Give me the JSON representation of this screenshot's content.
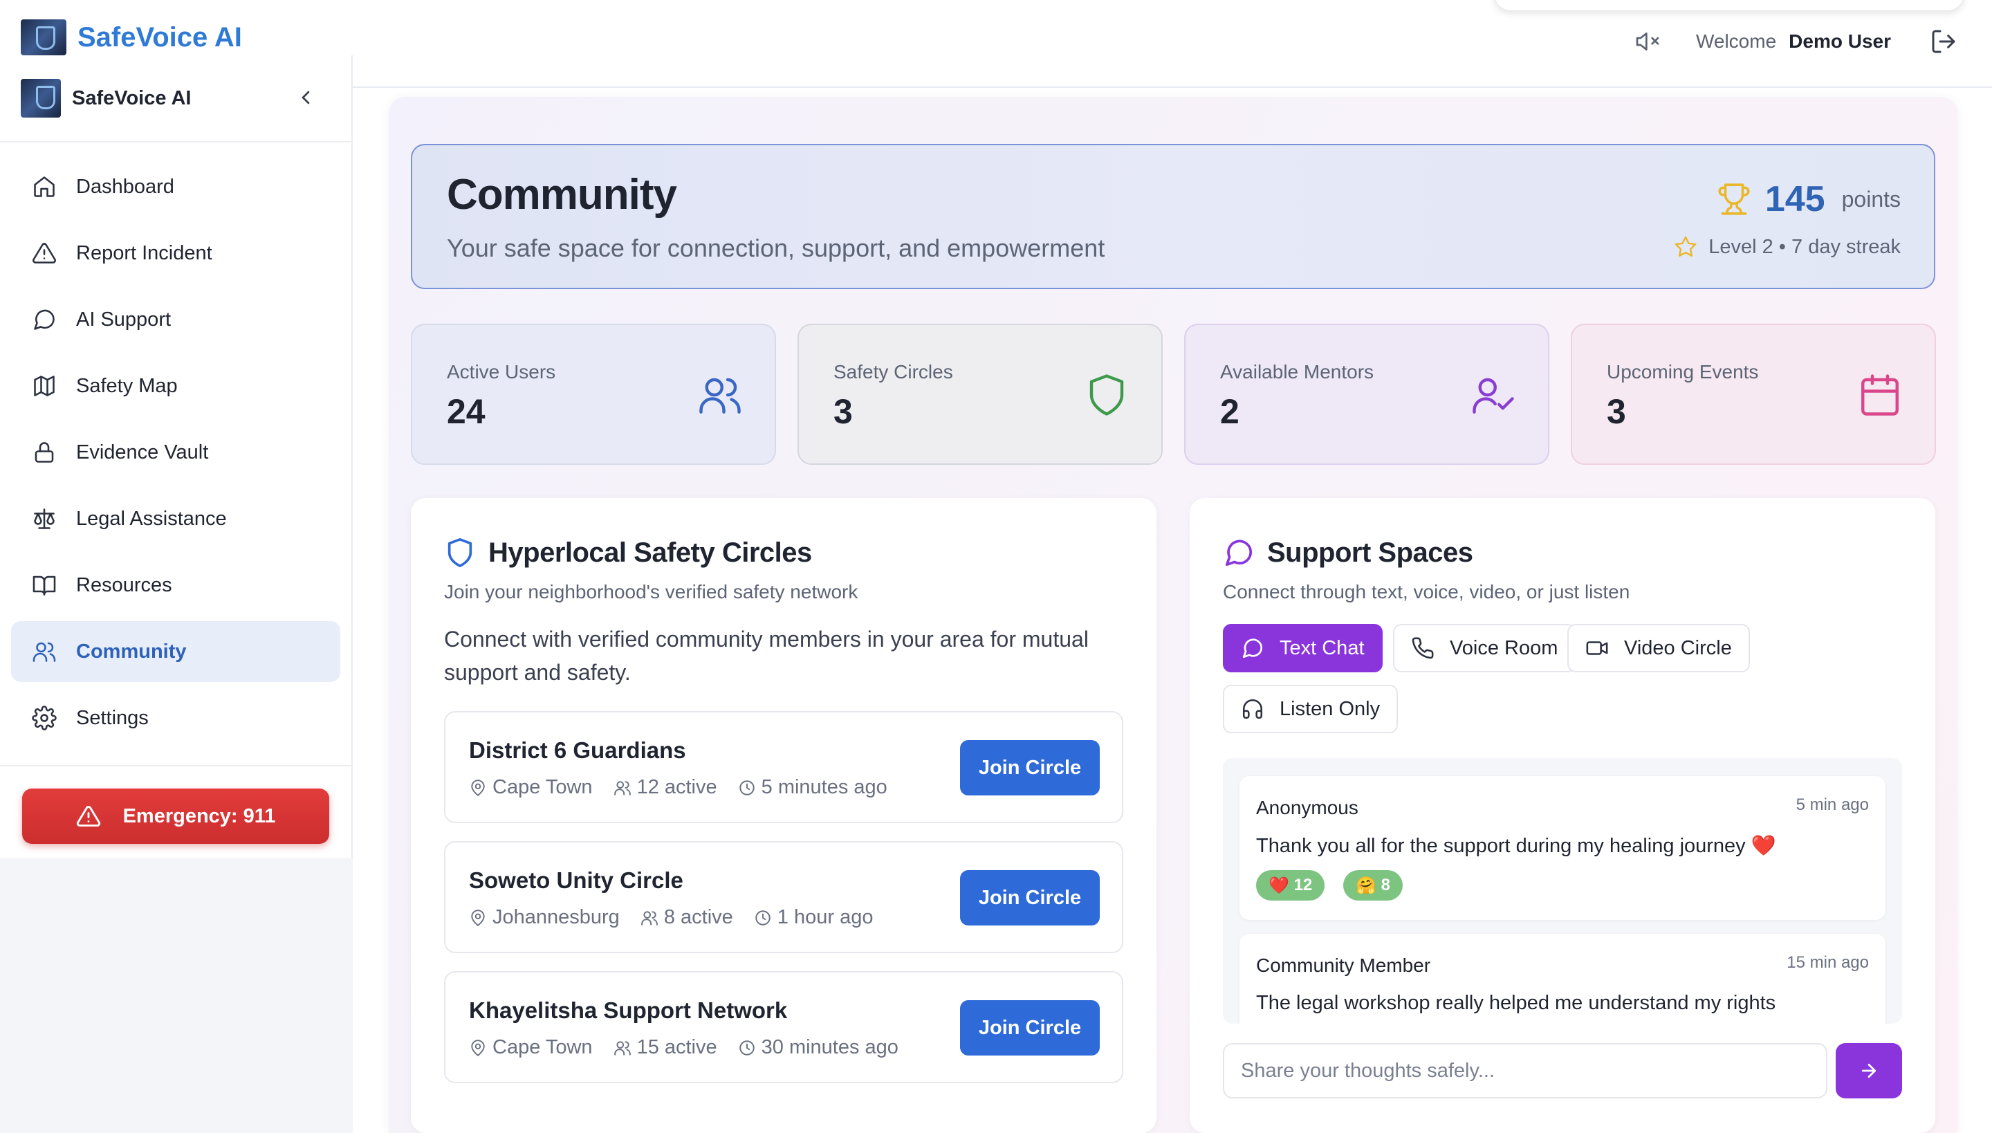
{
  "app": {
    "brand": "SafeVoice AI"
  },
  "header": {
    "welcome_label": "Welcome",
    "user_name": "Demo User",
    "icons": {
      "mute": "volume-mute-icon",
      "logout": "logout-icon"
    }
  },
  "sidebar": {
    "title": "SafeVoice AI",
    "items": [
      {
        "label": "Dashboard",
        "icon": "home-icon"
      },
      {
        "label": "Report Incident",
        "icon": "alert-triangle-icon"
      },
      {
        "label": "AI Support",
        "icon": "chat-bubble-icon"
      },
      {
        "label": "Safety Map",
        "icon": "map-icon"
      },
      {
        "label": "Evidence Vault",
        "icon": "lock-icon"
      },
      {
        "label": "Legal Assistance",
        "icon": "scales-icon"
      },
      {
        "label": "Resources",
        "icon": "book-icon"
      },
      {
        "label": "Community",
        "icon": "users-icon",
        "active": true
      },
      {
        "label": "Settings",
        "icon": "gear-icon"
      }
    ],
    "emergency_label": "Emergency: 911"
  },
  "hero": {
    "title": "Community",
    "subtitle": "Your safe space for connection, support, and empowerment",
    "points_value": "145",
    "points_label": "points",
    "level_text": "Level 2 • 7 day streak"
  },
  "stats": [
    {
      "label": "Active Users",
      "value": "24",
      "icon": "users-icon",
      "color": "#3a66c4"
    },
    {
      "label": "Safety Circles",
      "value": "3",
      "icon": "shield-icon",
      "color": "#3e9a4a"
    },
    {
      "label": "Available Mentors",
      "value": "2",
      "icon": "user-check-icon",
      "color": "#8a3ed0"
    },
    {
      "label": "Upcoming Events",
      "value": "3",
      "icon": "calendar-icon",
      "color": "#d9478a"
    }
  ],
  "circles_card": {
    "title": "Hyperlocal Safety Circles",
    "subtitle": "Join your neighborhood's verified safety network",
    "description": "Connect with verified community members in your area for mutual support and safety.",
    "join_label": "Join Circle",
    "items": [
      {
        "name": "District 6 Guardians",
        "location": "Cape Town",
        "active": "12 active",
        "time": "5 minutes ago"
      },
      {
        "name": "Soweto Unity Circle",
        "location": "Johannesburg",
        "active": "8 active",
        "time": "1 hour ago"
      },
      {
        "name": "Khayelitsha Support Network",
        "location": "Cape Town",
        "active": "15 active",
        "time": "30 minutes ago"
      }
    ]
  },
  "support_card": {
    "title": "Support Spaces",
    "subtitle": "Connect through text, voice, video, or just listen",
    "modes": [
      {
        "label": "Text Chat",
        "icon": "chat-bubble-icon",
        "active": true
      },
      {
        "label": "Voice Room",
        "icon": "phone-icon"
      },
      {
        "label": "Video Circle",
        "icon": "video-icon"
      },
      {
        "label": "Listen Only",
        "icon": "headphones-icon"
      }
    ],
    "posts": [
      {
        "author": "Anonymous",
        "time": "5 min ago",
        "text": "Thank you all for the support during my healing journey ❤️",
        "reactions": [
          {
            "emoji": "❤️",
            "count": "12"
          },
          {
            "emoji": "🤗",
            "count": "8"
          }
        ]
      },
      {
        "author": "Community Member",
        "time": "15 min ago",
        "text": "The legal workshop really helped me understand my rights"
      }
    ],
    "composer_placeholder": "Share your thoughts safely...",
    "accent_color": "#8a35dc"
  }
}
